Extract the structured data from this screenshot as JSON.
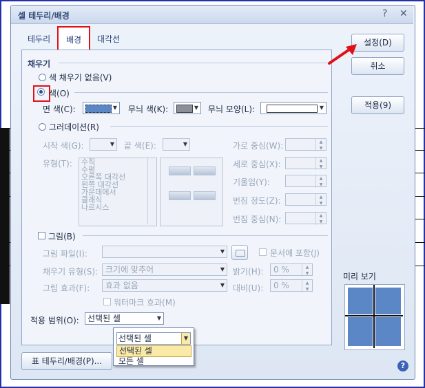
{
  "window": {
    "title": "셀 테두리/배경"
  },
  "tabs": [
    {
      "label": "테두리"
    },
    {
      "label": "배경"
    },
    {
      "label": "대각선"
    }
  ],
  "buttons": {
    "ok": "설정(D)",
    "cancel": "취소",
    "apply": "적용(9)",
    "table_border": "표 테두리/배경(P)..."
  },
  "fill": {
    "group": "채우기",
    "none": "색 채우기 없음(V)",
    "color": "색(O)",
    "face_color_label": "면 색(C):",
    "pattern_color_label": "무늬 색(K):",
    "pattern_shape_label": "무늬 모양(L):",
    "gradient": "그러데이션(R)",
    "start_color": "시작 색(G):",
    "end_color": "끝 색(E):",
    "type_label": "유형(T):",
    "types": [
      "수직",
      "수평",
      "오른쪽 대각선",
      "왼쪽 대각선",
      "가운데에서",
      "클래식",
      "나르시스"
    ],
    "h_center": "가로 중심(W):",
    "v_center": "세로 중심(X):",
    "tilt": "기울임(Y):",
    "blur_level": "번짐 정도(Z):",
    "blur_center": "번짐 중심(N):"
  },
  "picture": {
    "label": "그림(B)",
    "file_label": "그림 파일(I):",
    "embed": "문서에 포함(J)",
    "fill_type_label": "채우기 유형(S):",
    "fill_type_value": "크기에 맞추어",
    "brightness_label": "밝기(H):",
    "brightness_value": "0 %",
    "effect_label": "그림 효과(F):",
    "effect_value": "효과 없음",
    "contrast_label": "대비(U):",
    "contrast_value": "0 %",
    "watermark": "워터마크 효과(M)"
  },
  "scope": {
    "label": "적용 범위(O):",
    "value": "선택된 셀",
    "options": [
      "선택된 셀",
      "모든 셀"
    ]
  },
  "preview": {
    "label": "미리 보기"
  },
  "colors": {
    "accent": "#2a4a9a",
    "highlight": "#e01018",
    "face_color": "#5b87c6",
    "pattern_color": "#8a8f98",
    "popup_selected": "#fbe9a6"
  }
}
